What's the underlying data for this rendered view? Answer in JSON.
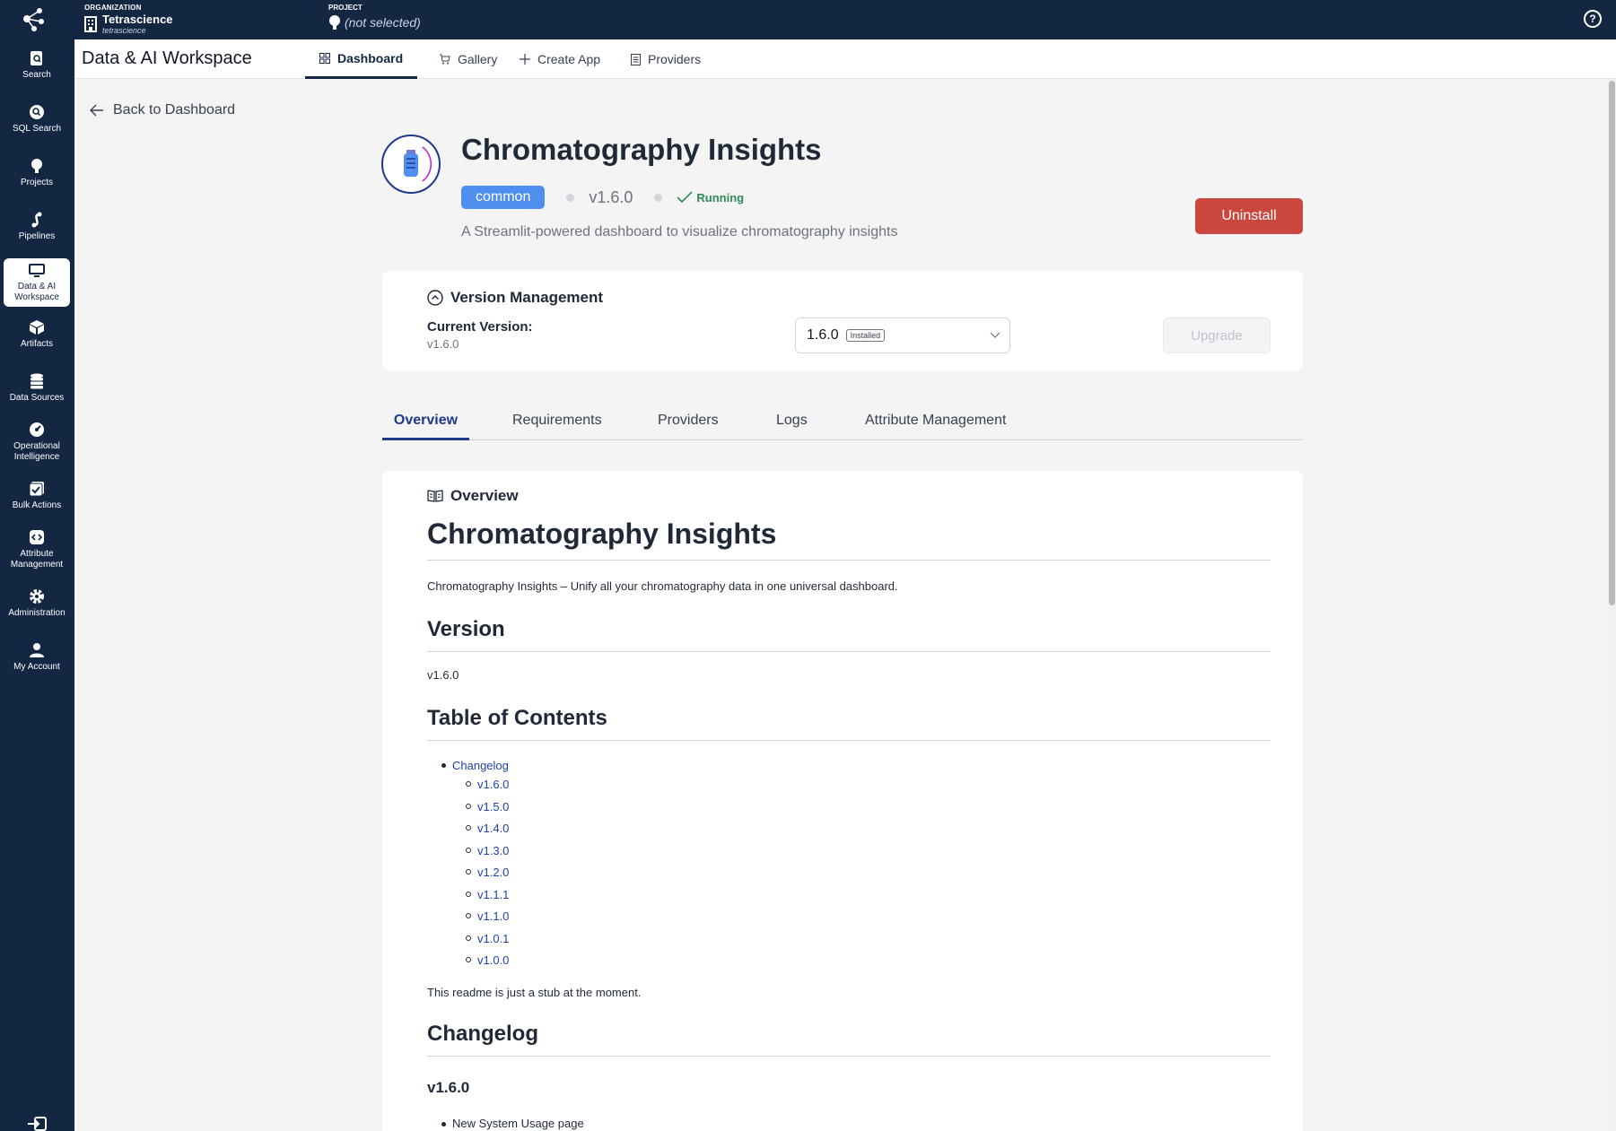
{
  "topbar": {
    "org_caption": "ORGANIZATION",
    "org_name": "Tetrascience",
    "org_slug": "tetrascience",
    "project_caption": "PROJECT",
    "project_value": "(not selected)",
    "help_label": "?"
  },
  "sidebar": {
    "items": [
      {
        "label": "Search",
        "icon": "search-doc-icon"
      },
      {
        "label": "SQL Search",
        "icon": "sql-search-icon"
      },
      {
        "label": "Projects",
        "icon": "lightbulb-icon"
      },
      {
        "label": "Pipelines",
        "icon": "pipeline-icon"
      },
      {
        "label": "Data & AI Workspace",
        "icon": "monitor-icon"
      },
      {
        "label": "Artifacts",
        "icon": "cube-icon"
      },
      {
        "label": "Data Sources",
        "icon": "database-icon"
      },
      {
        "label": "Operational Intelligence",
        "icon": "gauge-icon"
      },
      {
        "label": "Bulk Actions",
        "icon": "bulk-check-icon"
      },
      {
        "label": "Attribute Management",
        "icon": "code-tag-icon"
      },
      {
        "label": "Administration",
        "icon": "gear-icon"
      },
      {
        "label": "My Account",
        "icon": "user-icon"
      }
    ],
    "active": "Data & AI Workspace"
  },
  "header": {
    "title": "Data & AI Workspace",
    "tabs": [
      "Dashboard",
      "Gallery",
      "Create App",
      "Providers"
    ],
    "active_tab": "Dashboard"
  },
  "back_link": "Back to Dashboard",
  "app": {
    "title": "Chromatography Insights",
    "tag": "common",
    "version": "v1.6.0",
    "status": "Running",
    "description": "A Streamlit-powered dashboard to visualize chromatography insights",
    "uninstall_label": "Uninstall",
    "status_color": "#2e8b57",
    "uninstall_color": "#c9473d",
    "tag_color": "#4f8ff0"
  },
  "version_management": {
    "title": "Version Management",
    "current_label": "Current Version:",
    "current_value": "v1.6.0",
    "selected": "1.6.0",
    "selected_badge": "Installed",
    "upgrade_label": "Upgrade"
  },
  "tabs": [
    "Overview",
    "Requirements",
    "Providers",
    "Logs",
    "Attribute Management"
  ],
  "active_tab": "Overview",
  "overview": {
    "section_label": "Overview",
    "h1": "Chromatography Insights",
    "intro": "Chromatography Insights – Unify all your chromatography data in one universal dashboard.",
    "version_heading": "Version",
    "version_text": "v1.6.0",
    "toc_heading": "Table of Contents",
    "toc_top": "Changelog",
    "toc_items": [
      "v1.6.0",
      "v1.5.0",
      "v1.4.0",
      "v1.3.0",
      "v1.2.0",
      "v1.1.1",
      "v1.1.0",
      "v1.0.1",
      "v1.0.0"
    ],
    "stub_text": "This readme is just a stub at the moment.",
    "changelog_heading": "Changelog",
    "changelog_version": "v1.6.0",
    "changelog_first_item": "New System Usage page"
  }
}
